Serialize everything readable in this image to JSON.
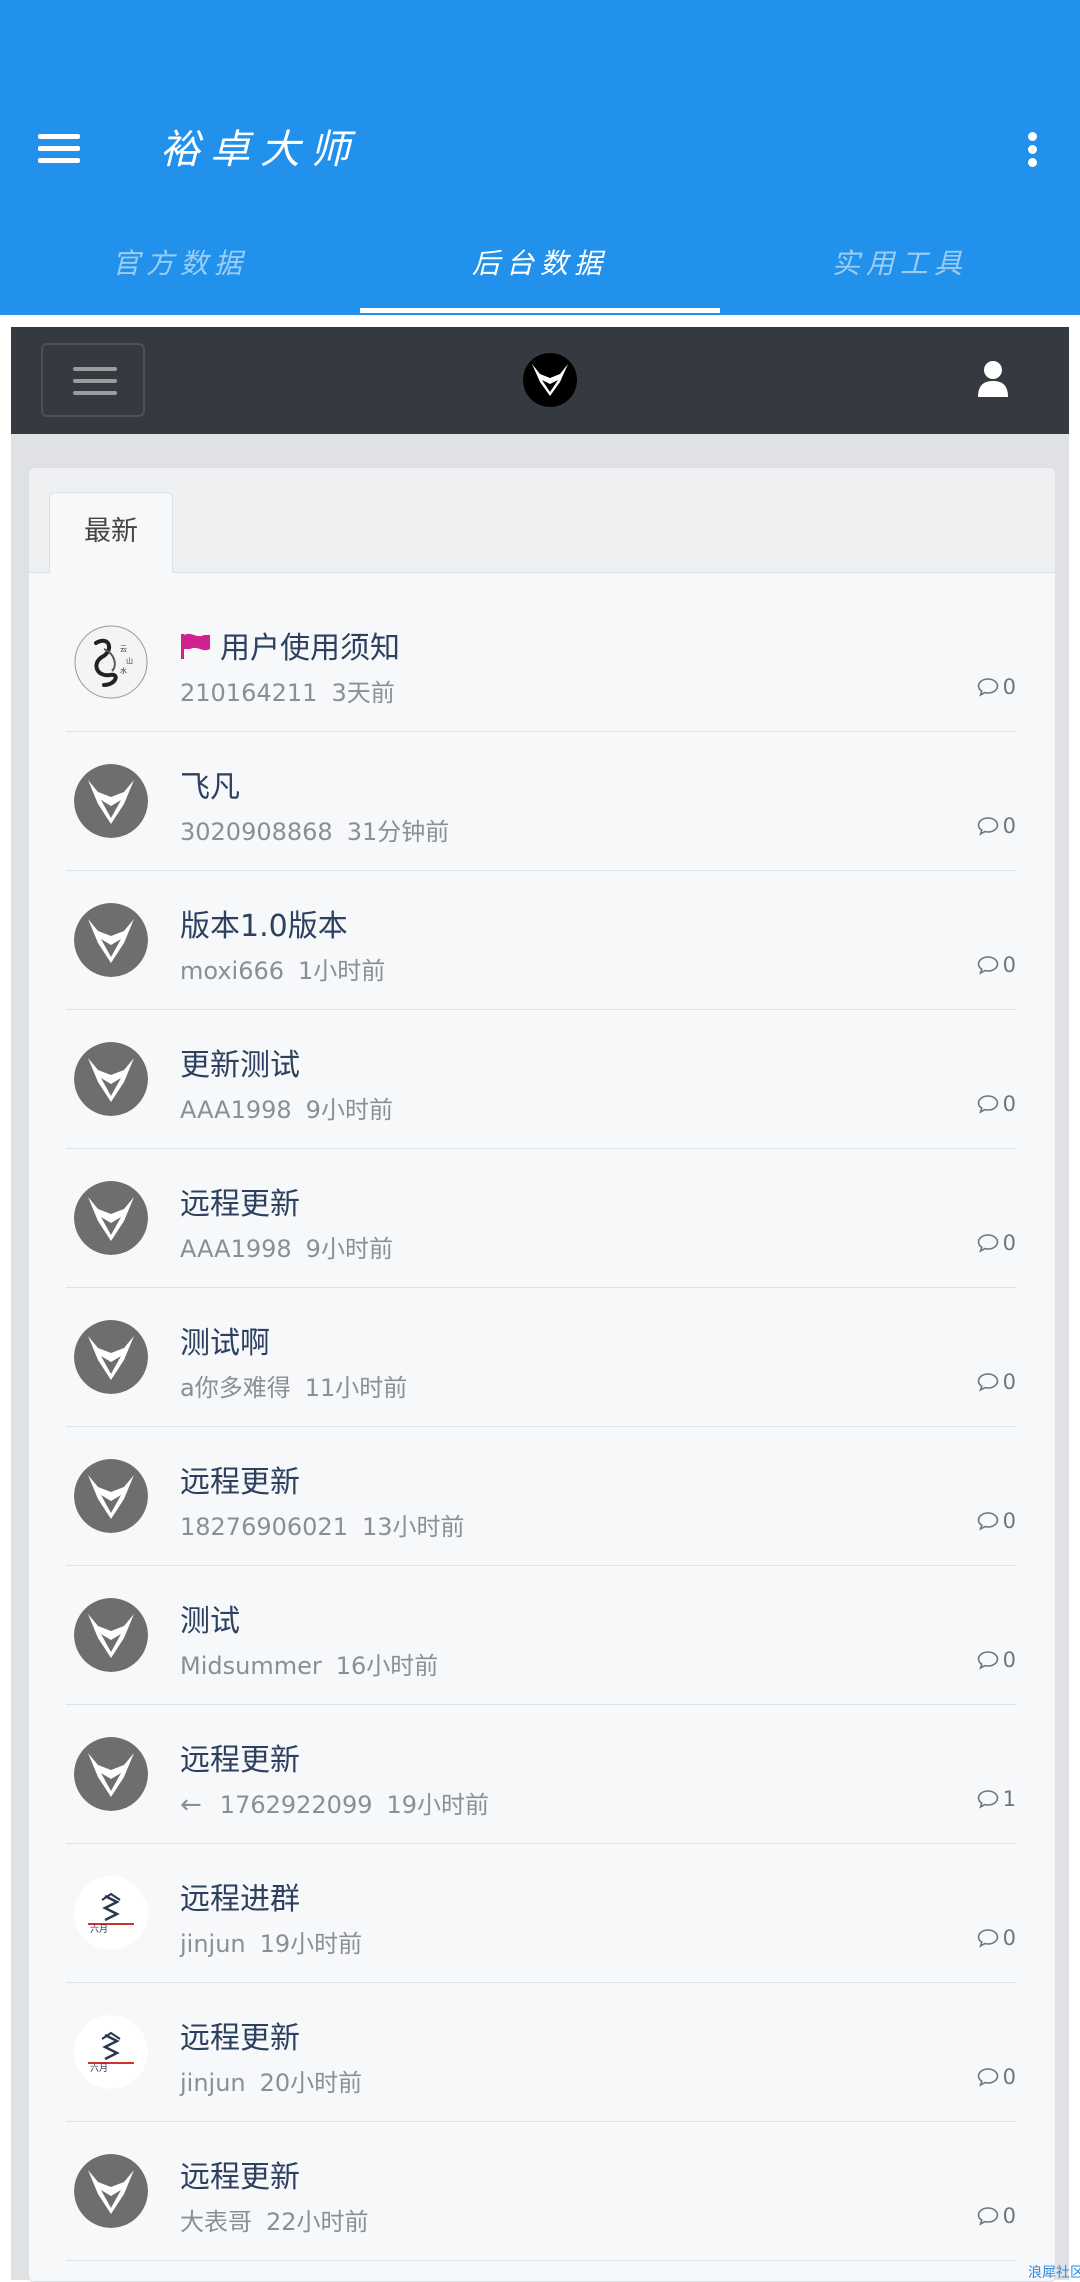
{
  "app": {
    "title": "裕卓大师",
    "tabs": [
      {
        "label": "官方数据"
      },
      {
        "label": "后台数据",
        "active": true
      },
      {
        "label": "实用工具"
      }
    ],
    "accent_color": "#2191ec"
  },
  "site": {
    "nav_bg": "#343a40",
    "card_tab": "最新"
  },
  "threads": [
    {
      "title": "用户使用须知",
      "pinned": true,
      "author": "210164211",
      "time": "3天前",
      "comments": "0",
      "avatar": "ink-dragon-avatar"
    },
    {
      "title": "飞凡",
      "author": "3020908868",
      "time": "31分钟前",
      "comments": "0",
      "avatar": "default-avatar"
    },
    {
      "title": "版本1.0版本",
      "author": "moxi666",
      "time": "1小时前",
      "comments": "0",
      "avatar": "default-avatar"
    },
    {
      "title": "更新测试",
      "author": "AAA1998",
      "time": "9小时前",
      "comments": "0",
      "avatar": "default-avatar"
    },
    {
      "title": "远程更新",
      "author": "AAA1998",
      "time": "9小时前",
      "comments": "0",
      "avatar": "default-avatar"
    },
    {
      "title": "测试啊",
      "author": "a你多难得",
      "time": "11小时前",
      "comments": "0",
      "avatar": "default-avatar"
    },
    {
      "title": "远程更新",
      "author": "18276906021",
      "time": "13小时前",
      "comments": "0",
      "avatar": "default-avatar"
    },
    {
      "title": "测试",
      "author": "Midsummer",
      "time": "16小时前",
      "comments": "0",
      "avatar": "default-avatar"
    },
    {
      "title": "远程更新",
      "reply": true,
      "reply_icon": "←",
      "author": "1762922099",
      "time": "19小时前",
      "comments": "1",
      "avatar": "default-avatar"
    },
    {
      "title": "远程进群",
      "author": "jinjun",
      "time": "19小时前",
      "comments": "0",
      "avatar": "logo-avatar"
    },
    {
      "title": "远程更新",
      "author": "jinjun",
      "time": "20小时前",
      "comments": "0",
      "avatar": "logo-avatar"
    },
    {
      "title": "远程更新",
      "author": "大表哥",
      "time": "22小时前",
      "comments": "0",
      "avatar": "default-avatar"
    }
  ],
  "watermark": "浪犀社区"
}
